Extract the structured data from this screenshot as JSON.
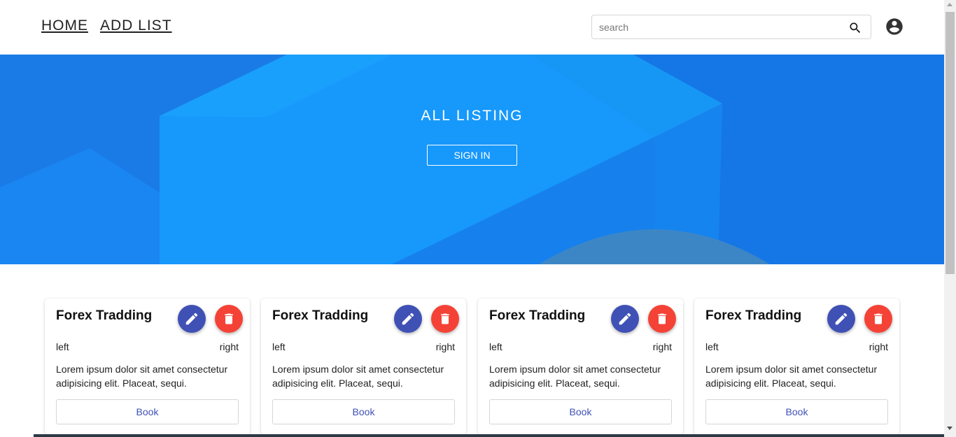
{
  "header": {
    "nav": {
      "home": "HOME",
      "add_list": "ADD LIST"
    },
    "search": {
      "placeholder": "search",
      "icon": "search-icon"
    },
    "account_icon": "account-circle-icon"
  },
  "hero": {
    "title": "ALL LISTING",
    "signin_label": "SIGN IN",
    "colors": {
      "base": "#1a8cf0",
      "dark": "#1574e2",
      "light": "#1798fb",
      "circle": "#3d86c6"
    }
  },
  "cards": [
    {
      "title": "Forex Tradding",
      "left": "left",
      "right": "right",
      "description": "Lorem ipsum dolor sit amet consectetur adipisicing elit. Placeat, sequi.",
      "book_label": "Book",
      "edit_icon": "pencil-icon",
      "delete_icon": "trash-icon"
    },
    {
      "title": "Forex Tradding",
      "left": "left",
      "right": "right",
      "description": "Lorem ipsum dolor sit amet consectetur adipisicing elit. Placeat, sequi.",
      "book_label": "Book",
      "edit_icon": "pencil-icon",
      "delete_icon": "trash-icon"
    },
    {
      "title": "Forex Tradding",
      "left": "left",
      "right": "right",
      "description": "Lorem ipsum dolor sit amet consectetur adipisicing elit. Placeat, sequi.",
      "book_label": "Book",
      "edit_icon": "pencil-icon",
      "delete_icon": "trash-icon"
    },
    {
      "title": "Forex Tradding",
      "left": "left",
      "right": "right",
      "description": "Lorem ipsum dolor sit amet consectetur adipisicing elit. Placeat, sequi.",
      "book_label": "Book",
      "edit_icon": "pencil-icon",
      "delete_icon": "trash-icon"
    }
  ],
  "colors": {
    "primary": "#3f51b5",
    "danger": "#f44336"
  }
}
